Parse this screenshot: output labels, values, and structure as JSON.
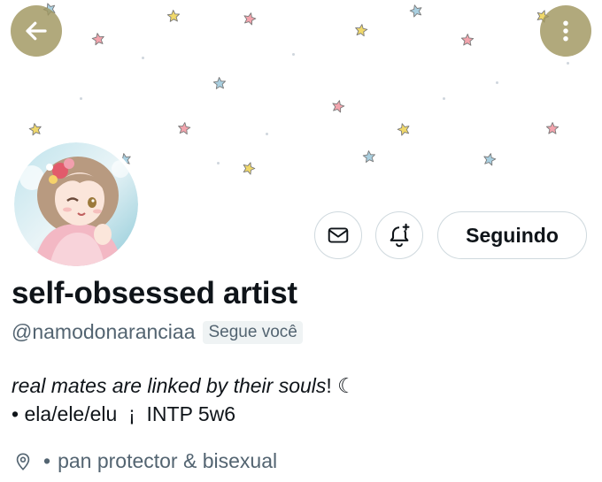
{
  "header": {
    "back_icon": "arrow-left-icon",
    "more_icon": "more-vertical-icon",
    "button_color": "#a0965f"
  },
  "banner": {
    "pattern": "pastel-stars",
    "star_colors": [
      "#f0d86a",
      "#f3a4ad",
      "#a9cfe0"
    ]
  },
  "profile": {
    "display_name": "self-obsessed artist",
    "handle": "@namodonaranciaa",
    "follows_you_label": "Segue você",
    "follow_button_label": "Seguindo",
    "message_icon": "envelope-icon",
    "notification_icon": "bell-plus-icon",
    "bio_line1_italic": "real mates are linked by their souls",
    "bio_line1_suffix": "! ☾",
    "bio_line2": "• ela/ele/elu  ¡  INTP 5w6",
    "location_icon": "location-pin-icon",
    "location_bullet": "•",
    "location": "pan protector & bisexual"
  },
  "colors": {
    "text_primary": "#0f1419",
    "text_secondary": "#536471",
    "border": "#cfd9de"
  }
}
